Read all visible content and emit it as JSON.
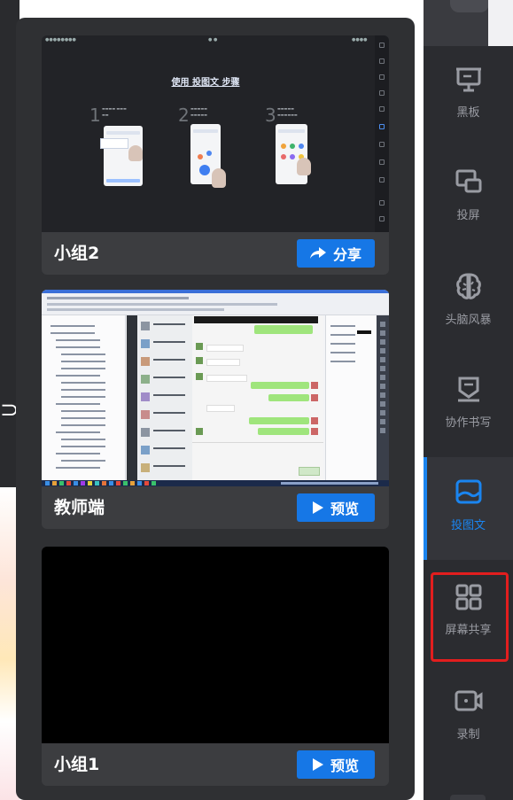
{
  "cards": [
    {
      "name": "小组2",
      "action": {
        "label": "分享",
        "icon": "share-arrow-icon"
      },
      "thumbnail": {
        "kind": "tutorial-slide",
        "title": "使用 投图文 步骤",
        "steps": [
          "1",
          "2",
          "3"
        ]
      }
    },
    {
      "name": "教师端",
      "action": {
        "label": "预览",
        "icon": "play-icon"
      },
      "thumbnail": {
        "kind": "desktop-screenshot"
      }
    },
    {
      "name": "小组1",
      "action": {
        "label": "预览",
        "icon": "play-icon"
      },
      "thumbnail": {
        "kind": "blank-black"
      }
    }
  ],
  "toolbar": {
    "items": [
      {
        "label": "黑板",
        "icon": "blackboard-icon",
        "active": false
      },
      {
        "label": "投屏",
        "icon": "cast-screen-icon",
        "active": false
      },
      {
        "label": "头脑风暴",
        "icon": "brain-icon",
        "active": false
      },
      {
        "label": "协作书写",
        "icon": "collab-write-icon",
        "active": false
      },
      {
        "label": "投图文",
        "icon": "image-text-icon",
        "active": true
      },
      {
        "label": "屏幕共享",
        "icon": "grid-screen-share-icon",
        "active": false,
        "highlighted": true
      },
      {
        "label": "录制",
        "icon": "record-camera-icon",
        "active": false
      }
    ]
  },
  "colors": {
    "panel": "#2f3033",
    "card": "#3c3d40",
    "button": "#1677e6",
    "toolbar": "#2b2c30",
    "active": "#1a85f0",
    "highlight": "#e21e1e"
  }
}
